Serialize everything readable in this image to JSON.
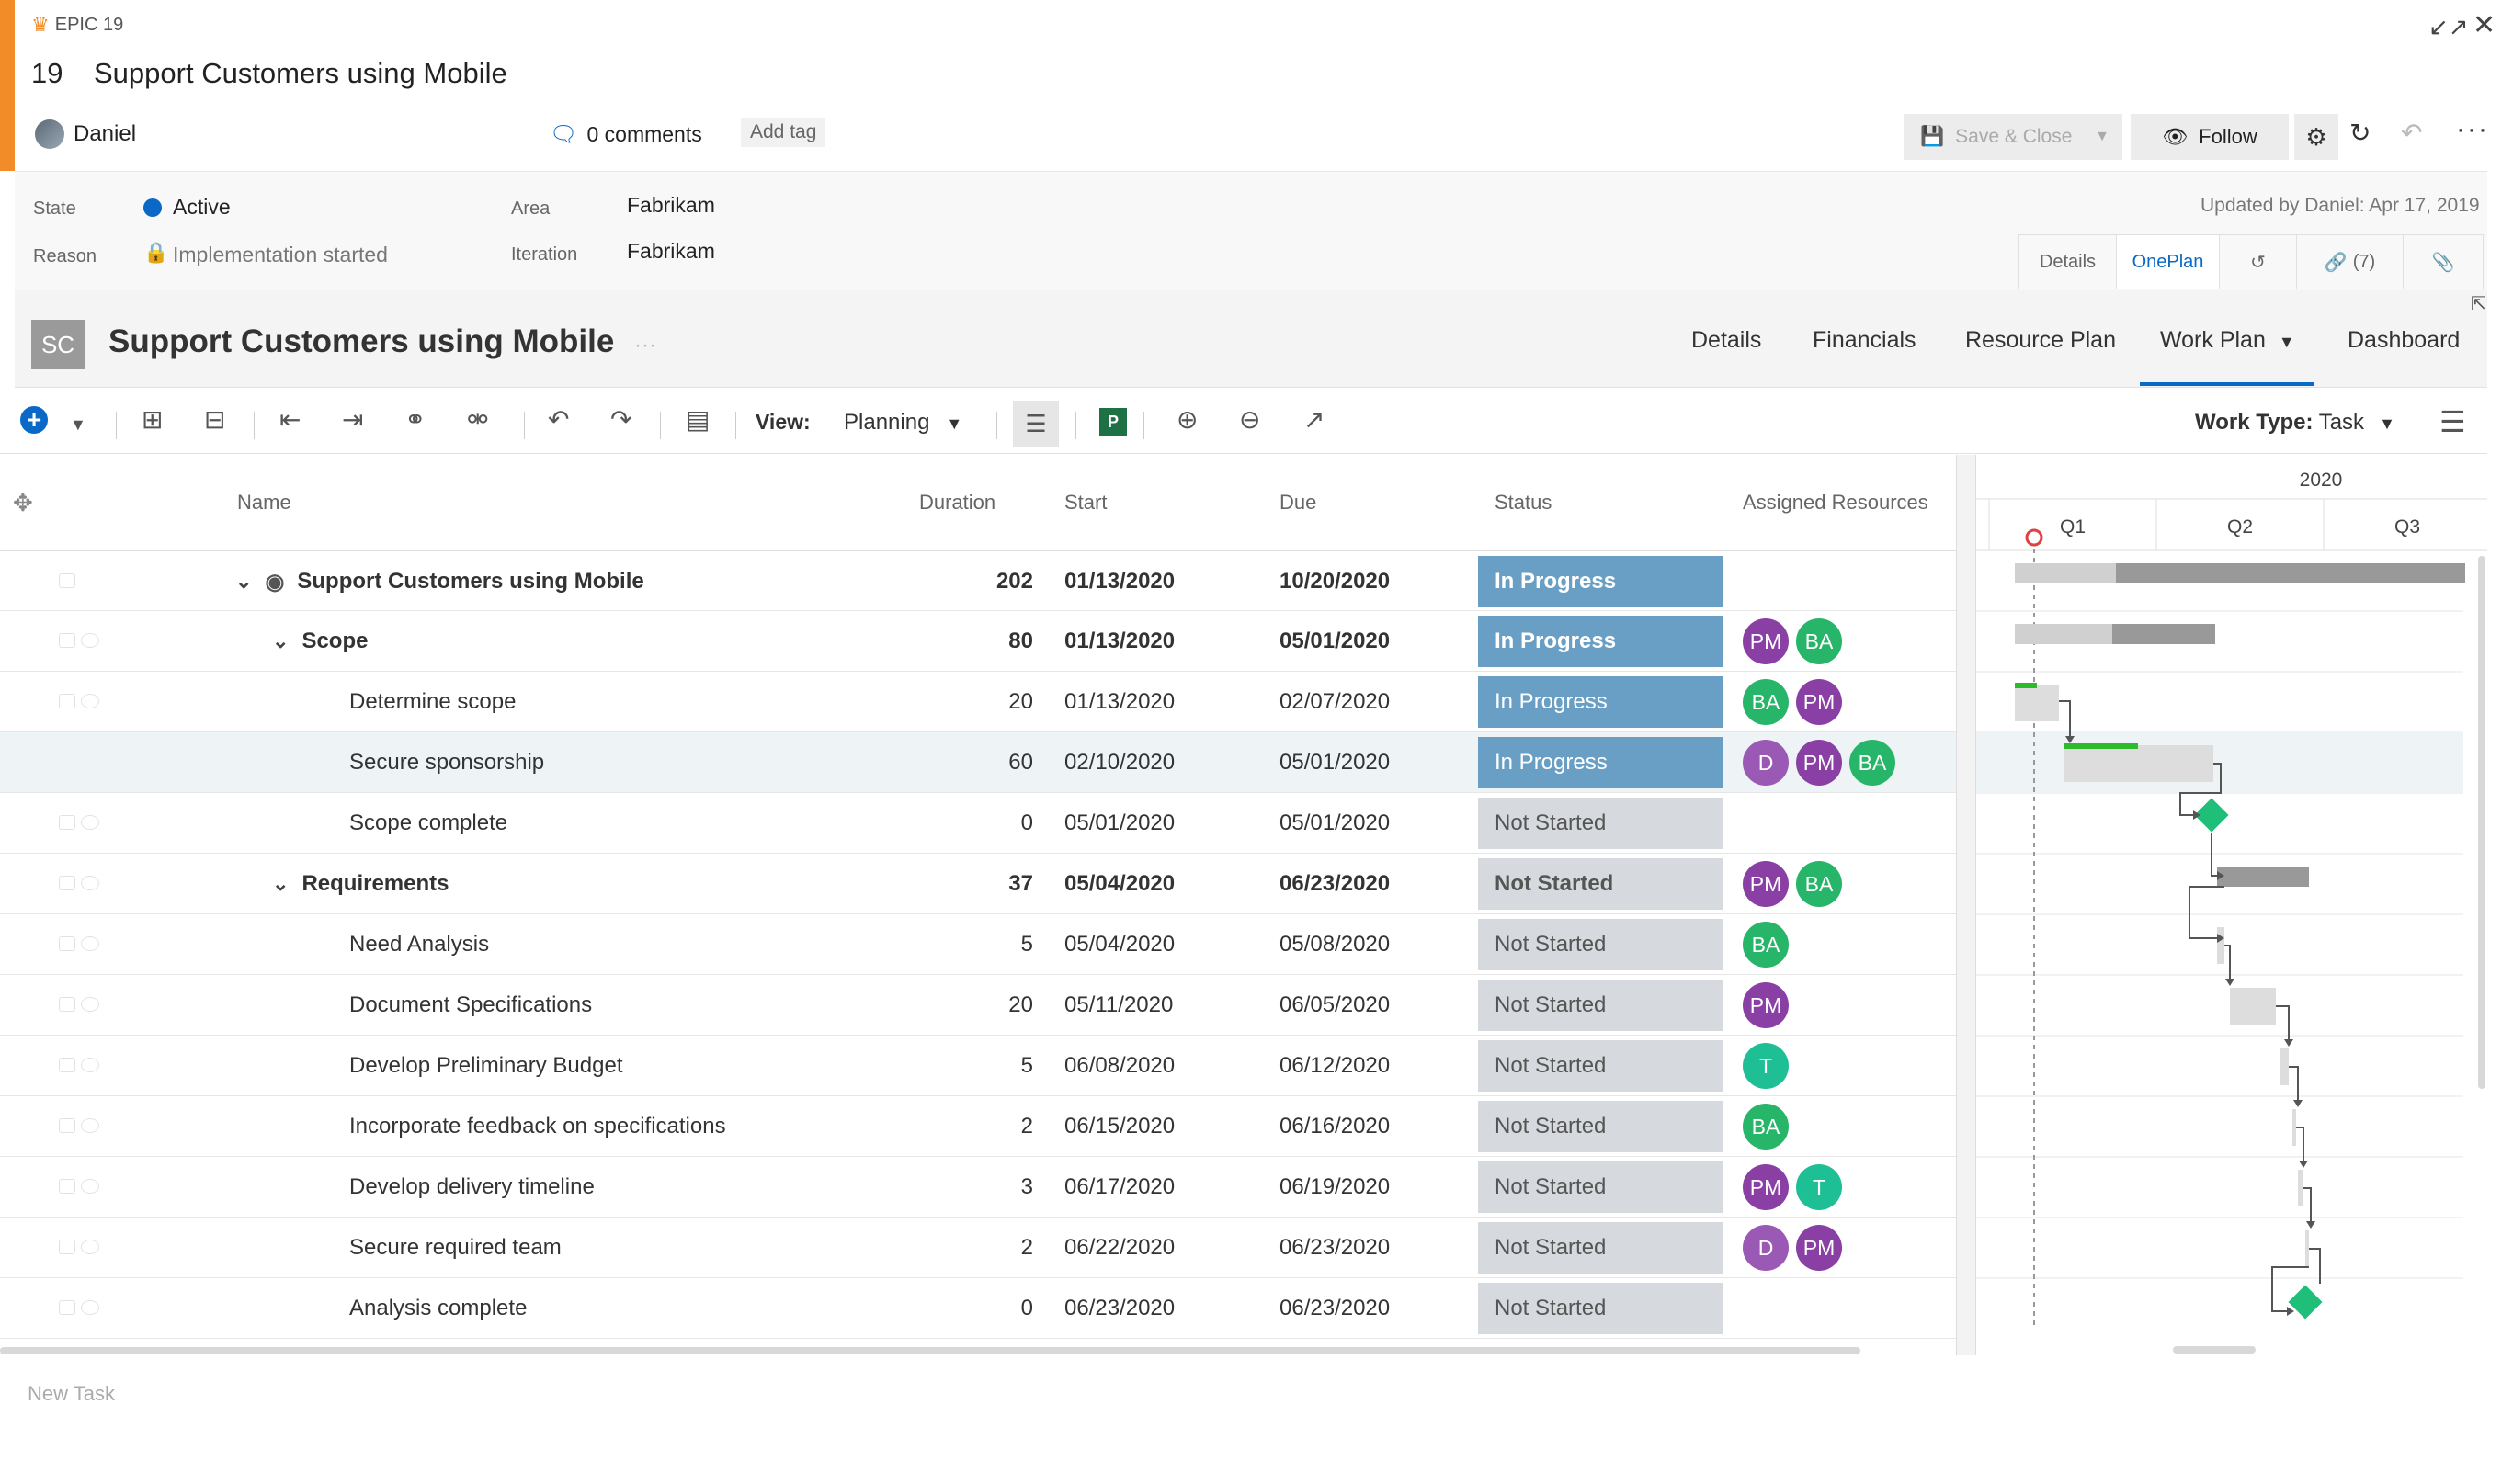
{
  "work_item": {
    "type_label": "EPIC 19",
    "id": "19",
    "title": "Support Customers using Mobile",
    "owner": "Daniel",
    "comments": "0 comments",
    "add_tag": "Add tag",
    "updated": "Updated by Daniel: Apr 17, 2019"
  },
  "actions": {
    "save_close": "Save & Close",
    "follow": "Follow"
  },
  "fields": {
    "state_label": "State",
    "state_value": "Active",
    "reason_label": "Reason",
    "reason_value": "Implementation started",
    "area_label": "Area",
    "area_value": "Fabrikam",
    "iteration_label": "Iteration",
    "iteration_value": "Fabrikam"
  },
  "wi_tabs": [
    "Details",
    "OnePlan",
    "",
    "(7)",
    ""
  ],
  "oneplan": {
    "badge": "SC",
    "title": "Support Customers using Mobile",
    "dots": "···",
    "tabs": [
      "Details",
      "Financials",
      "Resource Plan",
      "Work Plan",
      "Dashboard"
    ],
    "active_tab": "Work Plan"
  },
  "toolbar": {
    "view_label": "View:",
    "view_value": "Planning",
    "worktype_label": "Work Type:",
    "worktype_value": "Task",
    "project_icon": "P"
  },
  "columns": {
    "name": "Name",
    "duration": "Duration",
    "start": "Start",
    "due": "Due",
    "status": "Status",
    "resources": "Assigned Resources"
  },
  "rows": [
    {
      "name": "Support Customers using Mobile",
      "duration": "202",
      "start": "01/13/2020",
      "due": "10/20/2020",
      "status": "In Progress",
      "resources": []
    },
    {
      "name": "Scope",
      "duration": "80",
      "start": "01/13/2020",
      "due": "05/01/2020",
      "status": "In Progress",
      "resources": [
        "PM",
        "BA"
      ]
    },
    {
      "name": "Determine scope",
      "duration": "20",
      "start": "01/13/2020",
      "due": "02/07/2020",
      "status": "In Progress",
      "resources": [
        "BA",
        "PM"
      ]
    },
    {
      "name": "Secure sponsorship",
      "duration": "60",
      "start": "02/10/2020",
      "due": "05/01/2020",
      "status": "In Progress",
      "resources": [
        "D",
        "PM",
        "BA"
      ]
    },
    {
      "name": "Scope complete",
      "duration": "0",
      "start": "05/01/2020",
      "due": "05/01/2020",
      "status": "Not Started",
      "resources": []
    },
    {
      "name": "Requirements",
      "duration": "37",
      "start": "05/04/2020",
      "due": "06/23/2020",
      "status": "Not Started",
      "resources": [
        "PM",
        "BA"
      ]
    },
    {
      "name": "Need Analysis",
      "duration": "5",
      "start": "05/04/2020",
      "due": "05/08/2020",
      "status": "Not Started",
      "resources": [
        "BA"
      ]
    },
    {
      "name": "Document Specifications",
      "duration": "20",
      "start": "05/11/2020",
      "due": "06/05/2020",
      "status": "Not Started",
      "resources": [
        "PM"
      ]
    },
    {
      "name": "Develop Preliminary Budget",
      "duration": "5",
      "start": "06/08/2020",
      "due": "06/12/2020",
      "status": "Not Started",
      "resources": [
        "T"
      ]
    },
    {
      "name": "Incorporate feedback on specifications",
      "duration": "2",
      "start": "06/15/2020",
      "due": "06/16/2020",
      "status": "Not Started",
      "resources": [
        "BA"
      ]
    },
    {
      "name": "Develop delivery timeline",
      "duration": "3",
      "start": "06/17/2020",
      "due": "06/19/2020",
      "status": "Not Started",
      "resources": [
        "PM",
        "T"
      ]
    },
    {
      "name": "Secure required team",
      "duration": "2",
      "start": "06/22/2020",
      "due": "06/23/2020",
      "status": "Not Started",
      "resources": [
        "D",
        "PM"
      ]
    },
    {
      "name": "Analysis complete",
      "duration": "0",
      "start": "06/23/2020",
      "due": "06/23/2020",
      "status": "Not Started",
      "resources": []
    }
  ],
  "gantt": {
    "year": "2020",
    "quarters": [
      "Q1",
      "Q2",
      "Q3"
    ]
  },
  "new_task": "New Task",
  "colors": {
    "accent_orange": "#f28c28",
    "link_blue": "#0a69c7",
    "in_progress": "#6a9fc5",
    "not_started": "#d6d9dd",
    "pm": "#8a3fa5",
    "ba": "#27b56a",
    "t": "#1fbf96",
    "milestone": "#1fbf7a"
  }
}
